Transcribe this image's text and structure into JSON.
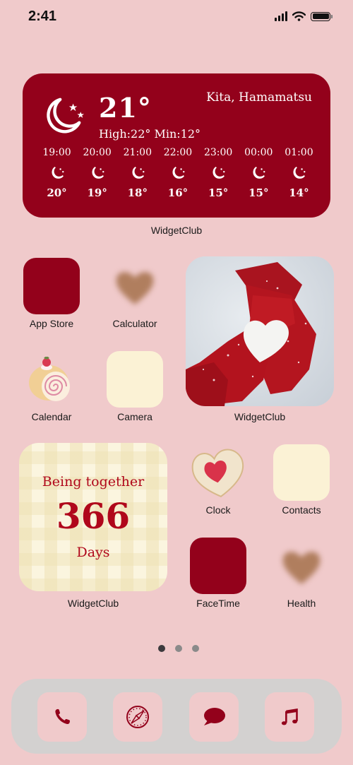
{
  "status_bar": {
    "time": "2:41",
    "icons": [
      "signal-icon",
      "wifi-icon",
      "battery-icon"
    ]
  },
  "colors": {
    "background": "#f0cacb",
    "accent_red": "#93011b",
    "cream": "#fbf2d5",
    "dock": "#d3d1d0"
  },
  "weather_widget": {
    "current_icon": "moon-stars-icon",
    "temperature": "21°",
    "high_low": "High:22° Min:12°",
    "location": "Kita, Hamamatsu",
    "hourly": [
      {
        "time": "19:00",
        "icon": "moon-stars-icon",
        "temp": "20°"
      },
      {
        "time": "20:00",
        "icon": "moon-stars-icon",
        "temp": "19°"
      },
      {
        "time": "21:00",
        "icon": "moon-stars-icon",
        "temp": "18°"
      },
      {
        "time": "22:00",
        "icon": "moon-stars-icon",
        "temp": "16°"
      },
      {
        "time": "23:00",
        "icon": "moon-stars-icon",
        "temp": "15°"
      },
      {
        "time": "00:00",
        "icon": "moon-stars-icon",
        "temp": "15°"
      },
      {
        "time": "01:00",
        "icon": "moon-stars-icon",
        "temp": "14°"
      }
    ],
    "label": "WidgetClub"
  },
  "apps": {
    "app_store": "App Store",
    "calculator": "Calculator",
    "calendar": "Calendar",
    "camera": "Camera",
    "clock": "Clock",
    "contacts": "Contacts",
    "facetime": "FaceTime",
    "health": "Health"
  },
  "photo_widget": {
    "description": "red knit gloves holding a snow heart",
    "label": "WidgetClub"
  },
  "counter_widget": {
    "top_text": "Being together",
    "count": "366",
    "unit": "Days",
    "label": "WidgetClub"
  },
  "page_dots": {
    "count": 3,
    "active_index": 0
  },
  "dock": [
    {
      "name": "phone",
      "icon": "phone-icon"
    },
    {
      "name": "safari",
      "icon": "compass-icon"
    },
    {
      "name": "messages",
      "icon": "speech-bubble-icon"
    },
    {
      "name": "music",
      "icon": "music-note-icon"
    }
  ]
}
